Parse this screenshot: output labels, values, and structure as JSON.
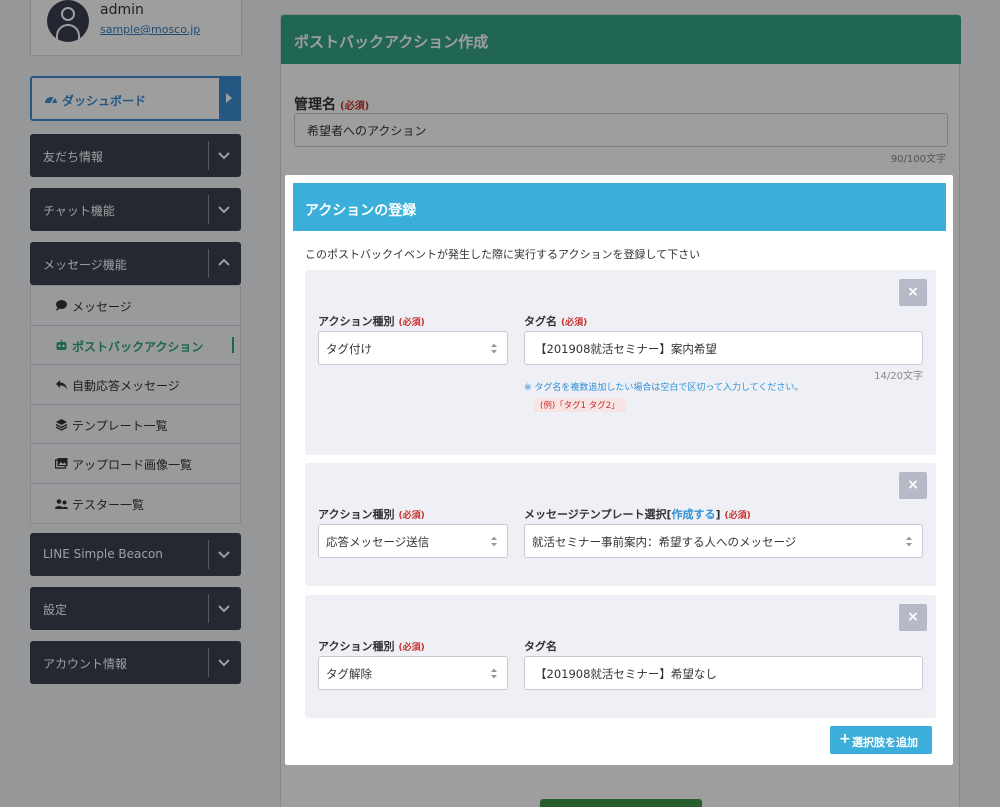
{
  "user": {
    "name": "admin",
    "email": "sample@mosco.jp"
  },
  "sidebar": {
    "dashboard": "ダッシュボード",
    "items": [
      {
        "label": "友だち情報"
      },
      {
        "label": "チャット機能"
      },
      {
        "label": "メッセージ機能"
      },
      {
        "label": "LINE Simple Beacon"
      },
      {
        "label": "設定"
      },
      {
        "label": "アカウント情報"
      }
    ],
    "submenu": [
      {
        "label": "メッセージ",
        "icon": "speech-bubble-icon"
      },
      {
        "label": "ポストバックアクション",
        "icon": "robot-icon"
      },
      {
        "label": "自動応答メッセージ",
        "icon": "reply-icon"
      },
      {
        "label": "テンプレート一覧",
        "icon": "layers-icon"
      },
      {
        "label": "アップロード画像一覧",
        "icon": "images-icon"
      },
      {
        "label": "テスター一覧",
        "icon": "users-icon"
      }
    ]
  },
  "page": {
    "title": "ポストバックアクション作成",
    "name_label": "管理名",
    "required": "(必須)",
    "name_value": "希望者へのアクション",
    "name_count": "90/100文字"
  },
  "modal": {
    "title": "アクションの登録",
    "description": "このポストバックイベントが発生した際に実行するアクションを登録して下さい",
    "close": "×",
    "type_label": "アクション種別",
    "required": "(必須)",
    "cards": [
      {
        "type_value": "タグ付け",
        "target_label": "タグ名",
        "target_required": "(必須)",
        "target_value": "【201908就活セミナー】案内希望",
        "count": "14/20文字",
        "note": "※ タグ名を複数追加したい場合は空白で区切って入力してください。",
        "example": "(例)「タグ1 タグ2」"
      },
      {
        "type_value": "応答メッセージ送信",
        "target_label_prefix": "メッセージテンプレート選択[",
        "target_label_link": "作成する",
        "target_label_suffix": "]",
        "target_required": "(必須)",
        "target_value": "就活セミナー事前案内：希望する人へのメッセージ"
      },
      {
        "type_value": "タグ解除",
        "target_label": "タグ名",
        "target_value": "【201908就活セミナー】希望なし"
      }
    ],
    "add_button": "選択肢を追加"
  },
  "colors": {
    "sidebar_dark": "#3b4150",
    "accent_blue": "#3a8fd4",
    "header_green": "#36a486",
    "modal_blue": "#3bafda",
    "required_red": "#c9302c"
  }
}
